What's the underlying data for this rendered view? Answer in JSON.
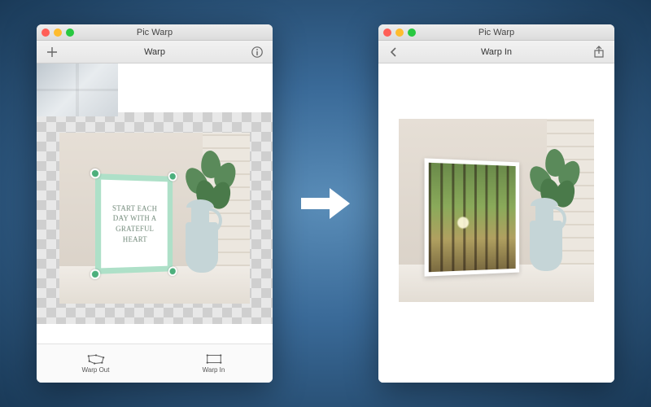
{
  "app": {
    "title": "Pic Warp"
  },
  "left_window": {
    "toolbar_title": "Warp",
    "sign_text": "START EACH DAY WITH A GRATEFUL HEART",
    "tabs": {
      "warp_out": "Warp Out",
      "warp_in": "Warp In"
    }
  },
  "right_window": {
    "toolbar_title": "Warp In"
  },
  "traffic": {
    "close": "close",
    "minimize": "minimize",
    "zoom": "zoom"
  }
}
